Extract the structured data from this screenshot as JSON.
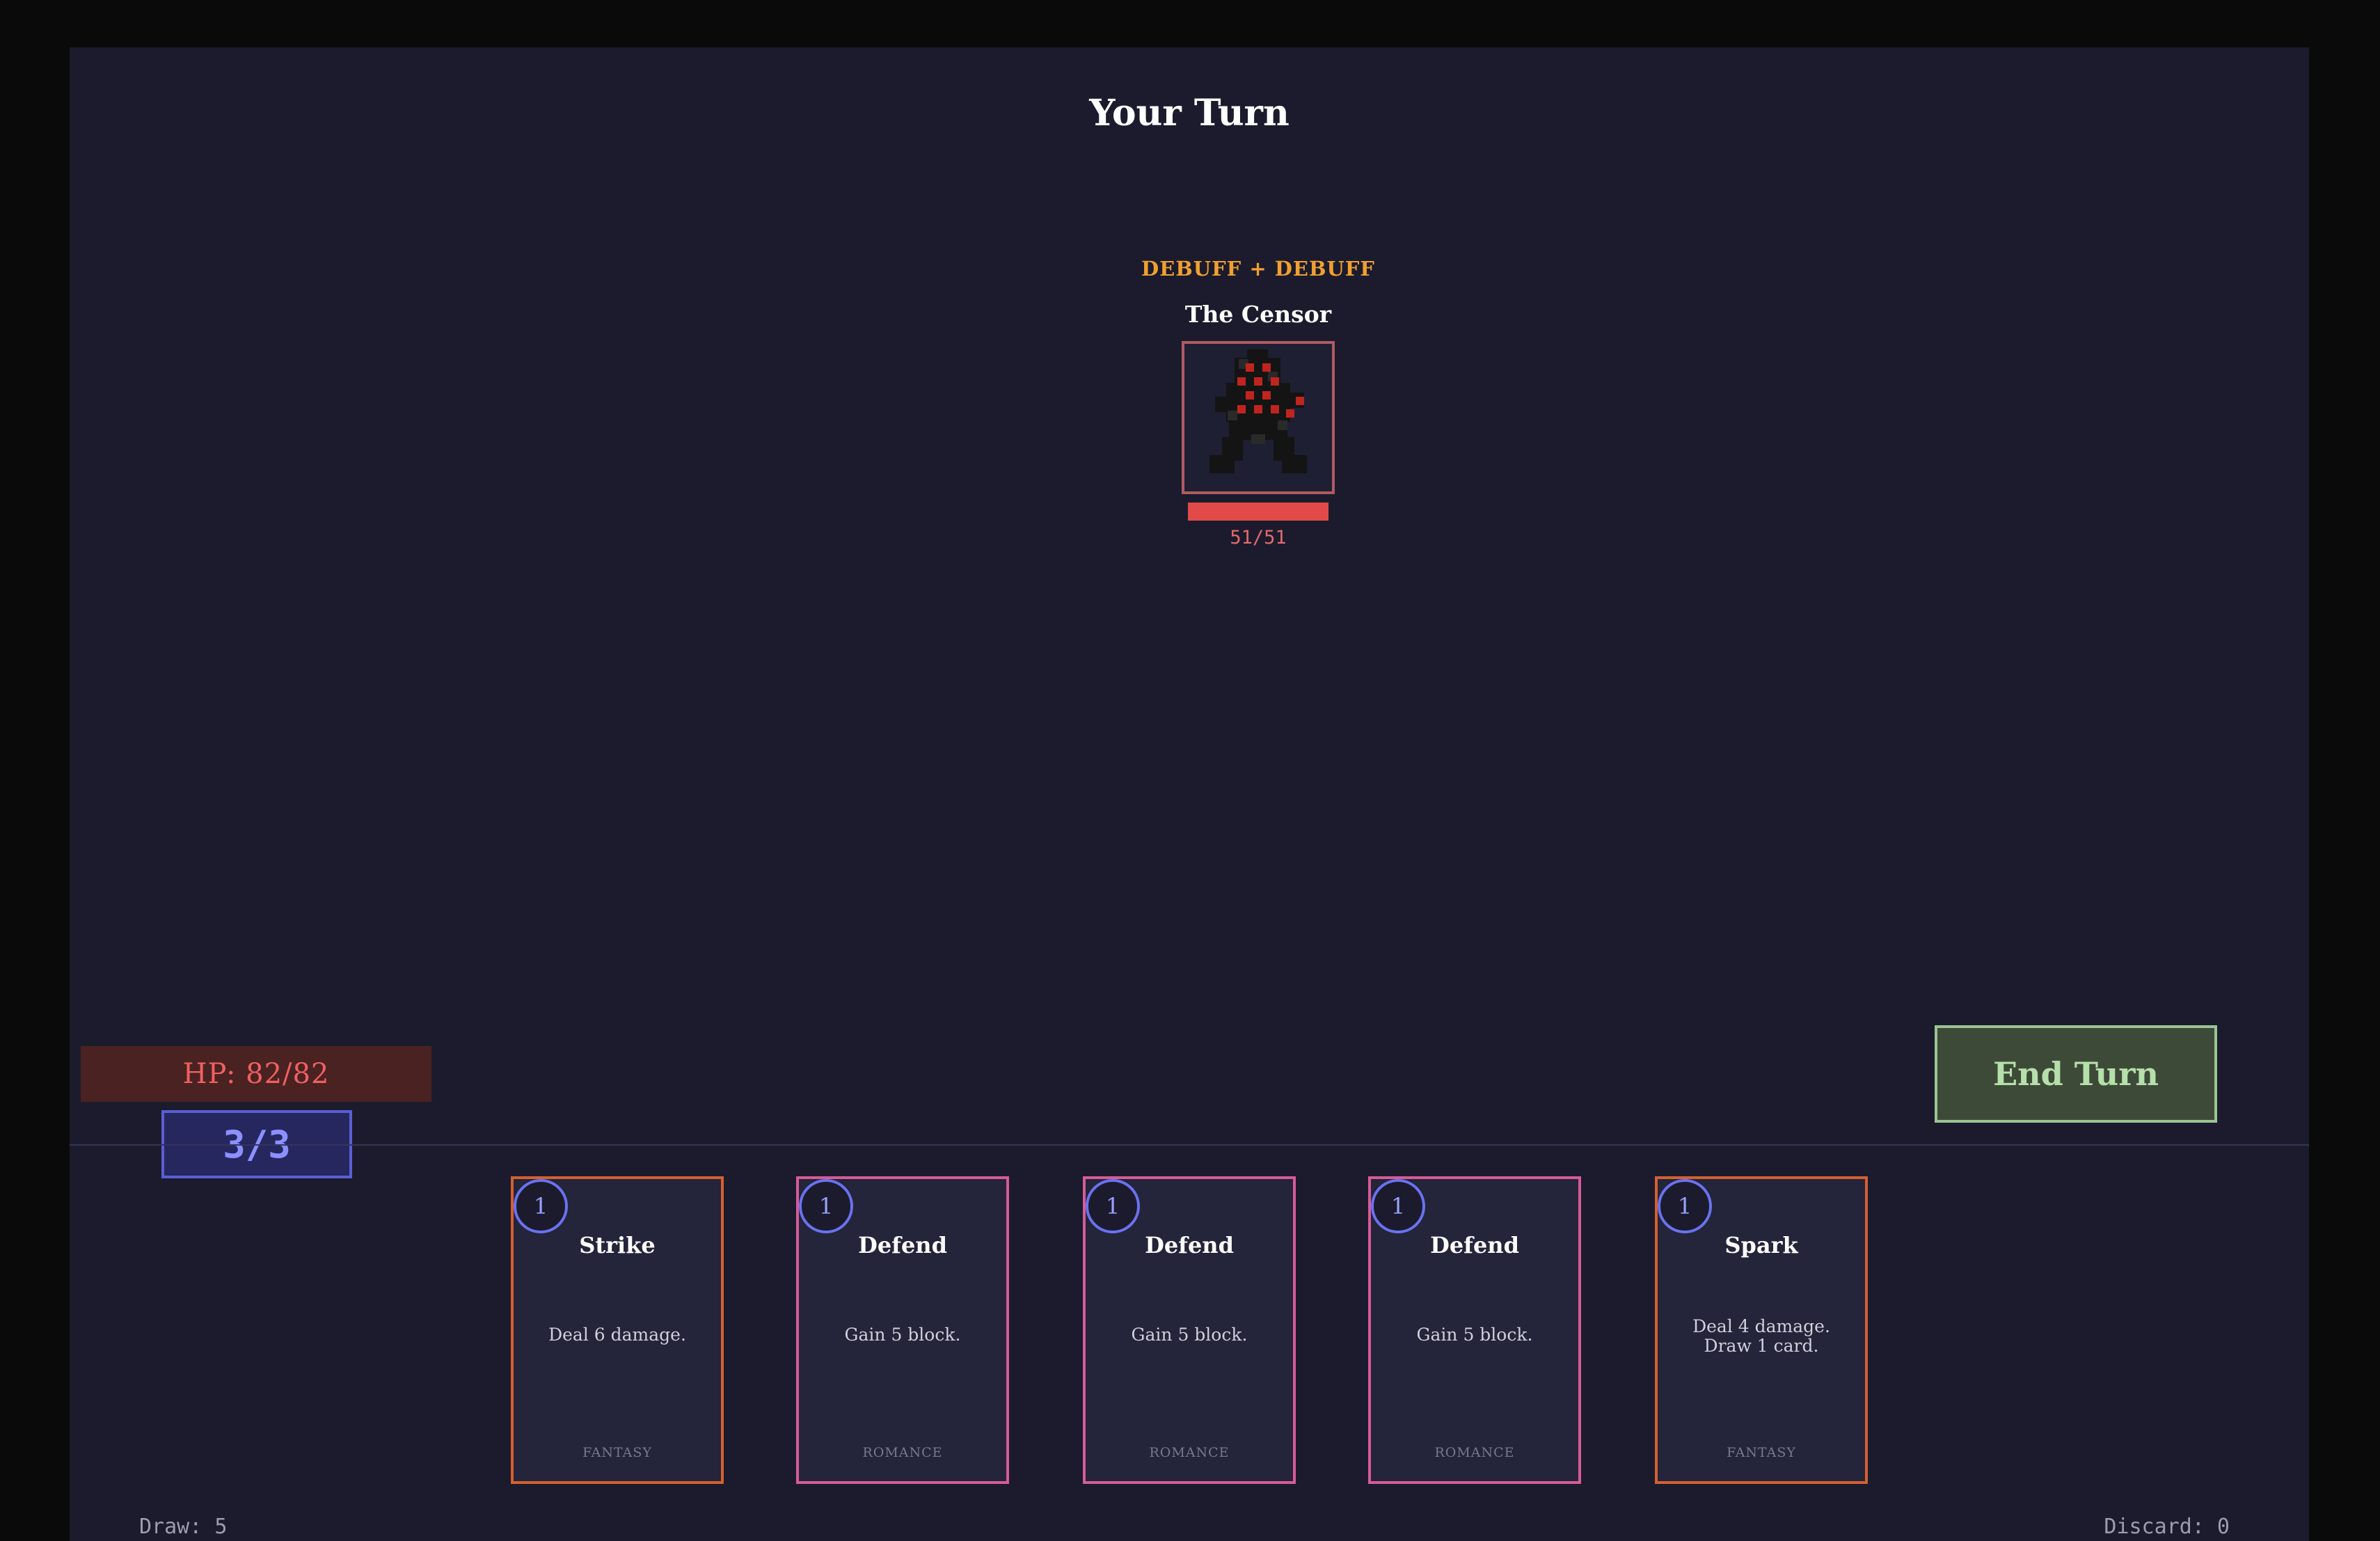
{
  "header": {
    "turn_label": "Your Turn"
  },
  "enemy": {
    "intent": "DEBUFF + DEBUFF",
    "name": "The Censor",
    "hp_text": "51/51",
    "hp_fraction": 1.0
  },
  "player": {
    "hp_text": "HP: 82/82",
    "energy_text": "3/3"
  },
  "controls": {
    "end_turn_label": "End Turn"
  },
  "hand": [
    {
      "cost": "1",
      "name": "Strike",
      "description": "Deal 6 damage.",
      "genre": "FANTASY"
    },
    {
      "cost": "1",
      "name": "Defend",
      "description": "Gain 5 block.",
      "genre": "ROMANCE"
    },
    {
      "cost": "1",
      "name": "Defend",
      "description": "Gain 5 block.",
      "genre": "ROMANCE"
    },
    {
      "cost": "1",
      "name": "Defend",
      "description": "Gain 5 block.",
      "genre": "ROMANCE"
    },
    {
      "cost": "1",
      "name": "Spark",
      "description": "Deal 4 damage.\nDraw 1 card.",
      "genre": "FANTASY"
    }
  ],
  "piles": {
    "draw_text": "Draw: 5",
    "discard_text": "Discard: 0"
  },
  "colors": {
    "background": "#1b1b2d",
    "fantasy_border": "#d46030",
    "romance_border": "#d65b98",
    "energy": "#6a72f0",
    "enemy_hp": "#e24a4a",
    "end_turn": "#9ac493"
  }
}
